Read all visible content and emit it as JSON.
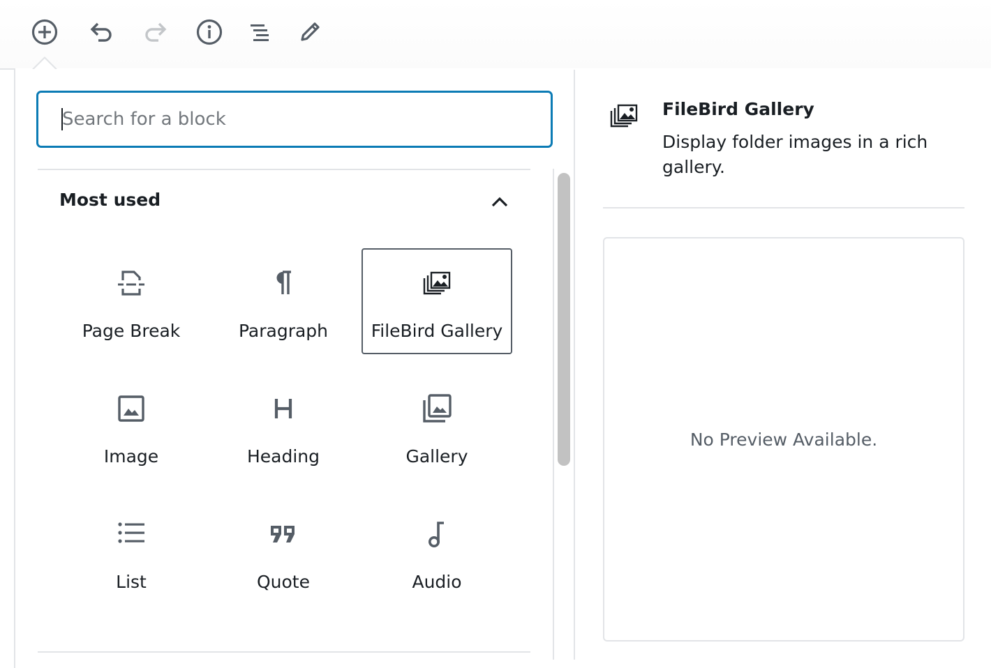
{
  "toolbar": {
    "buttons": [
      {
        "name": "add-block",
        "icon": "plus-circle-icon"
      },
      {
        "name": "undo",
        "icon": "undo-icon"
      },
      {
        "name": "redo",
        "icon": "redo-icon"
      },
      {
        "name": "info",
        "icon": "info-icon"
      },
      {
        "name": "outline",
        "icon": "list-view-icon"
      },
      {
        "name": "tools",
        "icon": "pencil-icon"
      }
    ]
  },
  "inserter": {
    "search": {
      "placeholder": "Search for a block",
      "value": ""
    },
    "panel": {
      "title": "Most used",
      "blocks": [
        {
          "label": "Page Break",
          "icon": "page-break-icon"
        },
        {
          "label": "Paragraph",
          "icon": "paragraph-icon"
        },
        {
          "label": "FileBird Gallery",
          "icon": "filebird-gallery-icon",
          "selected": true
        },
        {
          "label": "Image",
          "icon": "image-icon"
        },
        {
          "label": "Heading",
          "icon": "heading-icon"
        },
        {
          "label": "Gallery",
          "icon": "gallery-icon"
        },
        {
          "label": "List",
          "icon": "list-icon"
        },
        {
          "label": "Quote",
          "icon": "quote-icon"
        },
        {
          "label": "Audio",
          "icon": "audio-icon"
        }
      ]
    },
    "preview": {
      "title": "FileBird Gallery",
      "description": "Display folder images in a rich gallery.",
      "empty_text": "No Preview Available."
    }
  },
  "colors": {
    "accent": "#0b7bb5",
    "text": "#191e23",
    "icon": "#555d66",
    "icon_disabled": "#c3c6c9",
    "border": "#e2e4e7"
  }
}
